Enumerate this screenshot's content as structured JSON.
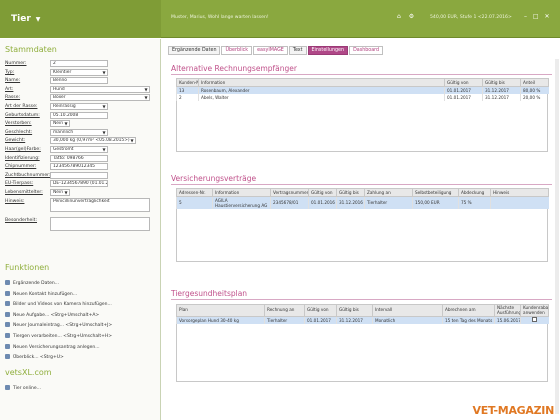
{
  "header": {
    "brand": "Tier",
    "user_text": "Muster, Marius, Wohl lange warten lassen!",
    "status_text": "540,00 EUR, Stufe 1 <22.07.2016>",
    "icons": [
      "home-icon",
      "settings-icon",
      "help-icon",
      "minimize-icon",
      "maximize-icon",
      "close-icon"
    ]
  },
  "sidebar": {
    "section_title": "Stammdaten",
    "fields": [
      {
        "label": "Nummer:",
        "value": "2",
        "dropdown": false
      },
      {
        "label": "Typ:",
        "value": "Kleintier",
        "dropdown": true
      },
      {
        "label": "Name:",
        "value": "Benno",
        "dropdown": false
      },
      {
        "label": "Art:",
        "value": "Hund",
        "dropdown": true
      },
      {
        "label": "Rasse:",
        "value": "Boxer",
        "dropdown": true
      },
      {
        "label": "Art der Rasse:",
        "value": "Reinrassig",
        "dropdown": true
      },
      {
        "label": "Geburtsdatum:",
        "value": "05.10.2008",
        "dropdown": false
      },
      {
        "label": "Verstorben:",
        "value": "Nein",
        "dropdown": true
      },
      {
        "label": "Geschlecht:",
        "value": "männlich",
        "dropdown": true
      },
      {
        "label": "Gewicht:",
        "value": "30,000 kg (0,97m² <05.08.2015>)",
        "dropdown": true
      },
      {
        "label": "Haar(gel)Farbe:",
        "value": "Gestromt",
        "dropdown": true
      },
      {
        "label": "Identifizierung:",
        "value": "Tätto: 098766",
        "dropdown": false
      },
      {
        "label": "Chipnummer:",
        "value": "123456789012345",
        "dropdown": false
      },
      {
        "label": "Zuchtbuchnummer:",
        "value": "",
        "dropdown": false
      },
      {
        "label": "EU-Tierpass:",
        "value": "DE-1234567890 (01.01.2007)",
        "dropdown": false
      },
      {
        "label": "Lebensmittelter:",
        "value": "Nein",
        "dropdown": true
      },
      {
        "label": "Hinweis:",
        "value": "Penicillinunverträglichkeit",
        "dropdown": false
      },
      {
        "label": "Besonderheit:",
        "value": "",
        "dropdown": false
      }
    ],
    "functions_title": "Funktionen",
    "functions": [
      "Ergänzende Daten...",
      "Neuen Kontakt hinzufügen...",
      "Bilder und Videos von Kamera hinzufügen...",
      "Neue Aufgabe... <Strg+Umschalt+A>",
      "Neuer Journaleintrag... <Strg+Umschalt+J>",
      "Tiergen verarbeiten... <Strg+Umschalt+H>",
      "Neuen Versicherungsantrag anlegen...",
      "Überblick... <Strg+U>"
    ],
    "vetsxl_title": "vetsXL.com",
    "vetsxl_items": [
      "Tier online..."
    ]
  },
  "tabs": [
    {
      "label": "Ergänzende Daten",
      "state": "normal"
    },
    {
      "label": "Überblick",
      "state": "link"
    },
    {
      "label": "easyIMAGE",
      "state": "link"
    },
    {
      "label": "Text",
      "state": "normal"
    },
    {
      "label": "Einstellungen",
      "state": "active"
    },
    {
      "label": "Dashboard",
      "state": "link"
    }
  ],
  "rechnung": {
    "title": "Alternative Rechnungsempfänger",
    "headers": [
      "Kunden-Nr.",
      "Information",
      "Gültig von",
      "Gültig bis",
      "Anteil"
    ],
    "rows": [
      [
        "13",
        "Rosenbaum, Alexander",
        "01.01.2017",
        "31.12.2017",
        "80,00 %"
      ],
      [
        "2",
        "Abels, Walter",
        "01.01.2017",
        "31.12.2017",
        "20,00 %"
      ]
    ]
  },
  "versicherung": {
    "title": "Versicherungsverträge",
    "headers": [
      "Adressen-Nr.",
      "Information",
      "Vertragsnummer",
      "Gültig von",
      "Gültig bis",
      "Zahlung an",
      "Selbstbeteiligung",
      "Abdeckung",
      "Hinweis"
    ],
    "rows": [
      [
        "5",
        "AGILA Haustierversicherung AG",
        "2345678/01",
        "01.01.2016",
        "31.12.2016",
        "Tierhalter",
        "150,00 EUR",
        "75 %",
        ""
      ]
    ]
  },
  "plan": {
    "title": "Tiergesundheitsplan",
    "headers": [
      "Plan",
      "Rechnung an",
      "Gültig von",
      "Gültig bis",
      "Intervall",
      "Abrechnen am",
      "Nächste Ausführung",
      "Kundenrabatte anwenden"
    ],
    "rows": [
      [
        "Vorsorgeplan Hund 30-40 kg",
        "Tierhalter",
        "01.01.2017",
        "31.12.2017",
        "Monatlich",
        "15 ten Tag des Monats",
        "15.06.2017",
        ""
      ]
    ]
  },
  "watermark": "VET-MAGAZIN",
  "colors": {
    "brand_green": "#8aa83f",
    "accent_pink": "#c0508a",
    "active_tab": "#b04888"
  }
}
